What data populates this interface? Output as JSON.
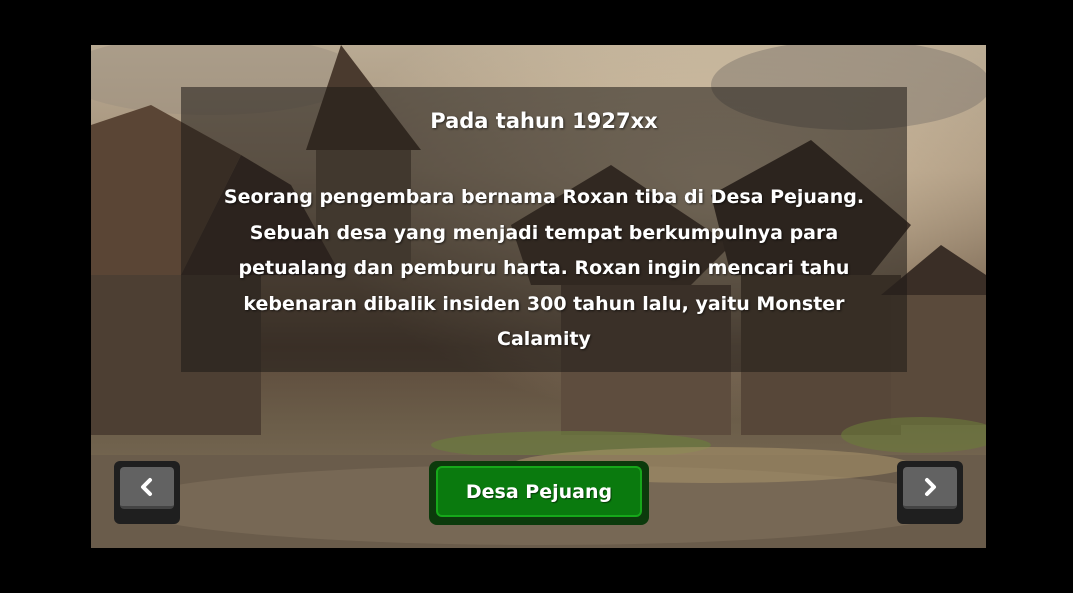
{
  "dialog": {
    "title": "Pada tahun 1927xx",
    "lines": [
      "Seorang pengembara bernama Roxan tiba di Desa Pejuang.",
      "Sebuah desa yang menjadi tempat berkumpulnya para",
      "petualang dan pemburu harta. Roxan ingin mencari tahu",
      "kebenaran dibalik insiden 300 tahun lalu, yaitu Monster",
      "Calamity"
    ]
  },
  "buttons": {
    "location_label": "Desa Pejuang",
    "prev_icon": "chevron-left-icon",
    "next_icon": "chevron-right-icon"
  },
  "colors": {
    "button_green": "#0a7a0e",
    "button_green_border": "#0c3a0c",
    "nav_gray": "#626262",
    "panel_overlay": "rgba(30,25,22,0.55)"
  }
}
